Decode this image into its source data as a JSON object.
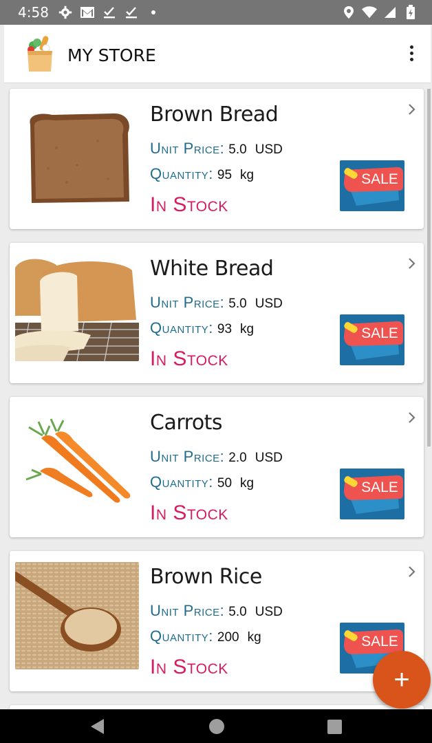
{
  "status_bar": {
    "time": "4:58",
    "left_icons": [
      "gear-icon",
      "gmail-icon",
      "check-icon",
      "check-icon",
      "dot-icon"
    ],
    "right_icons": [
      "location-icon",
      "wifi-icon",
      "signal-icon",
      "battery-icon"
    ]
  },
  "app_bar": {
    "title": "MY STORE",
    "logo": "grocery-bag-icon",
    "menu_icon": "overflow-menu-icon"
  },
  "labels": {
    "unit_price": "Unit Price:",
    "quantity": "Quantity:"
  },
  "products": [
    {
      "name": "Brown Bread",
      "unit_price": "5.0",
      "currency": "USD",
      "quantity": "95",
      "unit": "kg",
      "status": "In Stock",
      "image": "brown-bread",
      "sale_badge": "SALE"
    },
    {
      "name": "White Bread",
      "unit_price": "5.0",
      "currency": "USD",
      "quantity": "93",
      "unit": "kg",
      "status": "In Stock",
      "image": "white-bread",
      "sale_badge": "SALE"
    },
    {
      "name": "Carrots",
      "unit_price": "2.0",
      "currency": "USD",
      "quantity": "50",
      "unit": "kg",
      "status": "In Stock",
      "image": "carrots",
      "sale_badge": "SALE"
    },
    {
      "name": "Brown Rice",
      "unit_price": "5.0",
      "currency": "USD",
      "quantity": "200",
      "unit": "kg",
      "status": "In Stock",
      "image": "brown-rice",
      "sale_badge": "SALE"
    }
  ],
  "fab": {
    "label": "+",
    "icon": "add-icon"
  },
  "colors": {
    "label": "#1f6b8e",
    "stock": "#d81b60",
    "fab": "#d9541b",
    "status_bar": "#757575",
    "sale_badge": "#1d6fa3"
  }
}
